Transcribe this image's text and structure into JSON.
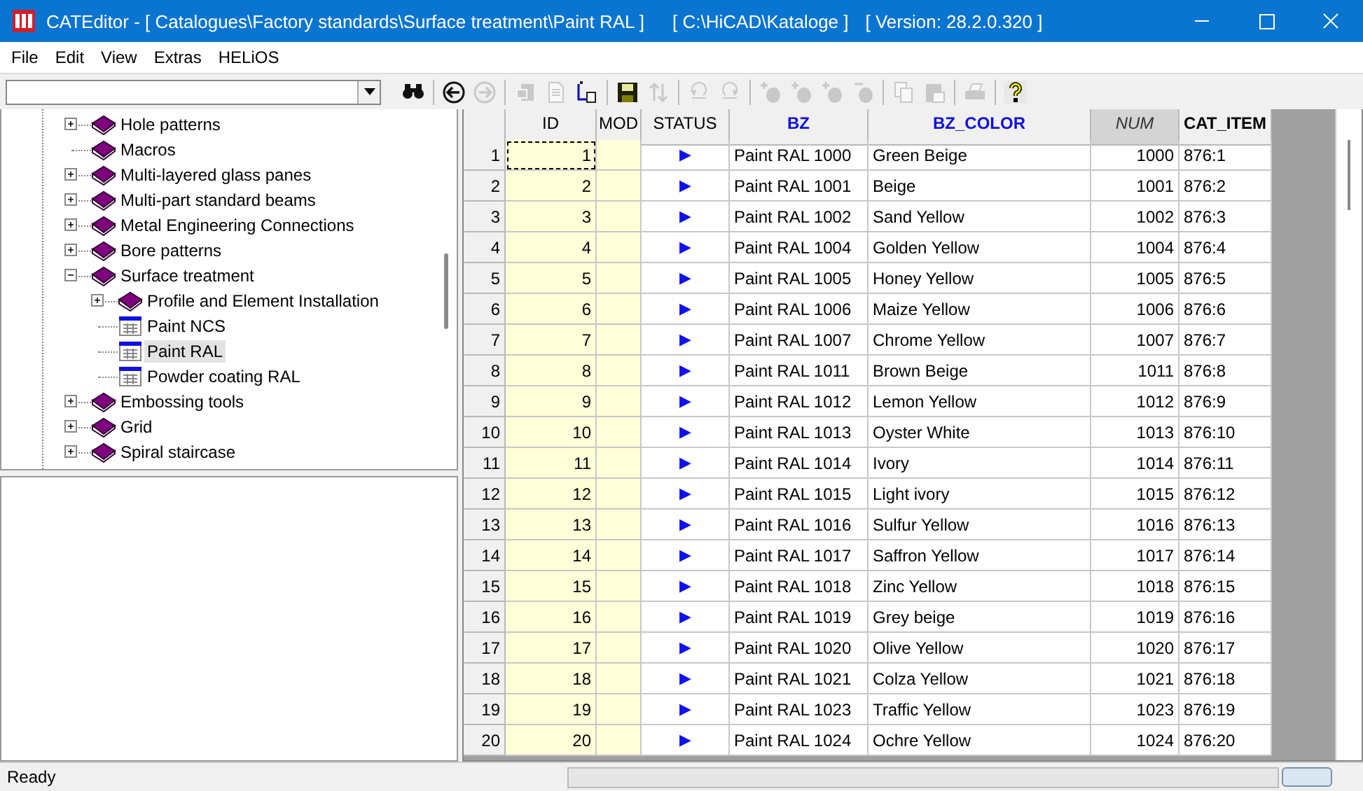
{
  "window": {
    "title": "CATEditor - [ Catalogues\\Factory standards\\Surface treatment\\Paint RAL ]",
    "path": "[ C:\\HiCAD\\Kataloge ]",
    "version": "[ Version: 28.2.0.320 ]"
  },
  "menu": [
    "File",
    "Edit",
    "View",
    "Extras",
    "HELiOS"
  ],
  "toolbar": [
    {
      "kind": "search",
      "disabled": false
    },
    {
      "kind": "sep"
    },
    {
      "kind": "back",
      "disabled": false
    },
    {
      "kind": "forward",
      "disabled": true
    },
    {
      "kind": "sep"
    },
    {
      "kind": "copy-record",
      "disabled": true
    },
    {
      "kind": "document",
      "disabled": true
    },
    {
      "kind": "insert",
      "disabled": false
    },
    {
      "kind": "sep"
    },
    {
      "kind": "save",
      "disabled": false
    },
    {
      "kind": "sort",
      "disabled": true
    },
    {
      "kind": "sep"
    },
    {
      "kind": "undo",
      "disabled": true
    },
    {
      "kind": "redo",
      "disabled": true
    },
    {
      "kind": "sep"
    },
    {
      "kind": "add-row",
      "disabled": true
    },
    {
      "kind": "add-row",
      "disabled": true
    },
    {
      "kind": "add-row",
      "disabled": true
    },
    {
      "kind": "remove-row",
      "disabled": true
    },
    {
      "kind": "sep"
    },
    {
      "kind": "copy",
      "disabled": true
    },
    {
      "kind": "paste",
      "disabled": true
    },
    {
      "kind": "sep"
    },
    {
      "kind": "print",
      "disabled": true
    },
    {
      "kind": "sep"
    },
    {
      "kind": "help",
      "disabled": false
    }
  ],
  "tree": [
    {
      "label": "Hole patterns",
      "kind": "book",
      "expanded": false,
      "selected": false
    },
    {
      "label": "Macros",
      "kind": "book",
      "selected": false
    },
    {
      "label": "Multi-layered glass panes",
      "kind": "book",
      "expanded": false,
      "selected": false
    },
    {
      "label": "Multi-part standard beams",
      "kind": "book",
      "expanded": false,
      "selected": false
    },
    {
      "label": "Metal Engineering Connections",
      "kind": "book",
      "expanded": false,
      "selected": false
    },
    {
      "label": "Bore patterns",
      "kind": "book",
      "expanded": false,
      "selected": false
    },
    {
      "label": "Surface treatment",
      "kind": "book",
      "expanded": true,
      "selected": false,
      "children": [
        {
          "label": "Profile and Element Installation",
          "kind": "book",
          "expanded": false,
          "selected": false
        },
        {
          "label": "Paint NCS",
          "kind": "table",
          "selected": false
        },
        {
          "label": "Paint RAL",
          "kind": "table",
          "selected": true
        },
        {
          "label": "Powder coating RAL",
          "kind": "table",
          "selected": false
        }
      ]
    },
    {
      "label": "Embossing tools",
      "kind": "book",
      "expanded": false,
      "selected": false
    },
    {
      "label": "Grid",
      "kind": "book",
      "expanded": false,
      "selected": false
    },
    {
      "label": "Spiral staircase",
      "kind": "book",
      "expanded": false,
      "selected": false
    }
  ],
  "table": {
    "columns": [
      {
        "label": "ID",
        "kind": "readonly"
      },
      {
        "label": "MOD",
        "kind": "readonly"
      },
      {
        "label": "STATUS",
        "kind": "status"
      },
      {
        "label": "BZ",
        "kind": "key"
      },
      {
        "label": "BZ_COLOR",
        "kind": "key"
      },
      {
        "label": "NUM",
        "kind": "sorted"
      },
      {
        "label": "CAT_ITEM",
        "kind": "bold"
      }
    ],
    "rows": [
      {
        "number": "1",
        "current": true,
        "cells": [
          "1",
          null,
          "▶",
          "Paint RAL 1000",
          "Green Beige",
          "1000",
          "876:1"
        ]
      },
      {
        "number": "2",
        "current": false,
        "cells": [
          "2",
          null,
          "▶",
          "Paint RAL 1001",
          "Beige",
          "1001",
          "876:2"
        ]
      },
      {
        "number": "3",
        "current": false,
        "cells": [
          "3",
          null,
          "▶",
          "Paint RAL 1002",
          "Sand Yellow",
          "1002",
          "876:3"
        ]
      },
      {
        "number": "4",
        "current": false,
        "cells": [
          "4",
          null,
          "▶",
          "Paint RAL 1004",
          "Golden Yellow",
          "1004",
          "876:4"
        ]
      },
      {
        "number": "5",
        "current": false,
        "cells": [
          "5",
          null,
          "▶",
          "Paint RAL 1005",
          "Honey Yellow",
          "1005",
          "876:5"
        ]
      },
      {
        "number": "6",
        "current": false,
        "cells": [
          "6",
          null,
          "▶",
          "Paint RAL 1006",
          "Maize Yellow",
          "1006",
          "876:6"
        ]
      },
      {
        "number": "7",
        "current": false,
        "cells": [
          "7",
          null,
          "▶",
          "Paint RAL 1007",
          "Chrome Yellow",
          "1007",
          "876:7"
        ]
      },
      {
        "number": "8",
        "current": false,
        "cells": [
          "8",
          null,
          "▶",
          "Paint RAL 1011",
          "Brown Beige",
          "1011",
          "876:8"
        ]
      },
      {
        "number": "9",
        "current": false,
        "cells": [
          "9",
          null,
          "▶",
          "Paint RAL 1012",
          "Lemon Yellow",
          "1012",
          "876:9"
        ]
      },
      {
        "number": "10",
        "current": false,
        "cells": [
          "10",
          null,
          "▶",
          "Paint RAL 1013",
          "Oyster White",
          "1013",
          "876:10"
        ]
      },
      {
        "number": "11",
        "current": false,
        "cells": [
          "11",
          null,
          "▶",
          "Paint RAL 1014",
          "Ivory",
          "1014",
          "876:11"
        ]
      },
      {
        "number": "12",
        "current": false,
        "cells": [
          "12",
          null,
          "▶",
          "Paint RAL 1015",
          "Light ivory",
          "1015",
          "876:12"
        ]
      },
      {
        "number": "13",
        "current": false,
        "cells": [
          "13",
          null,
          "▶",
          "Paint RAL 1016",
          "Sulfur Yellow",
          "1016",
          "876:13"
        ]
      },
      {
        "number": "14",
        "current": false,
        "cells": [
          "14",
          null,
          "▶",
          "Paint RAL 1017",
          "Saffron Yellow",
          "1017",
          "876:14"
        ]
      },
      {
        "number": "15",
        "current": false,
        "cells": [
          "15",
          null,
          "▶",
          "Paint RAL 1018",
          "Zinc Yellow",
          "1018",
          "876:15"
        ]
      },
      {
        "number": "16",
        "current": false,
        "cells": [
          "16",
          null,
          "▶",
          "Paint RAL 1019",
          "Grey beige",
          "1019",
          "876:16"
        ]
      },
      {
        "number": "17",
        "current": false,
        "cells": [
          "17",
          null,
          "▶",
          "Paint RAL 1020",
          "Olive Yellow",
          "1020",
          "876:17"
        ]
      },
      {
        "number": "18",
        "current": false,
        "cells": [
          "18",
          null,
          "▶",
          "Paint RAL 1021",
          "Colza Yellow",
          "1021",
          "876:18"
        ]
      },
      {
        "number": "19",
        "current": false,
        "cells": [
          "19",
          null,
          "▶",
          "Paint RAL 1023",
          "Traffic Yellow",
          "1023",
          "876:19"
        ]
      },
      {
        "number": "20",
        "current": false,
        "cells": [
          "20",
          null,
          "▶",
          "Paint RAL 1024",
          "Ochre Yellow",
          "1024",
          "876:20"
        ]
      }
    ]
  },
  "status_bar": {
    "text": "Ready"
  }
}
